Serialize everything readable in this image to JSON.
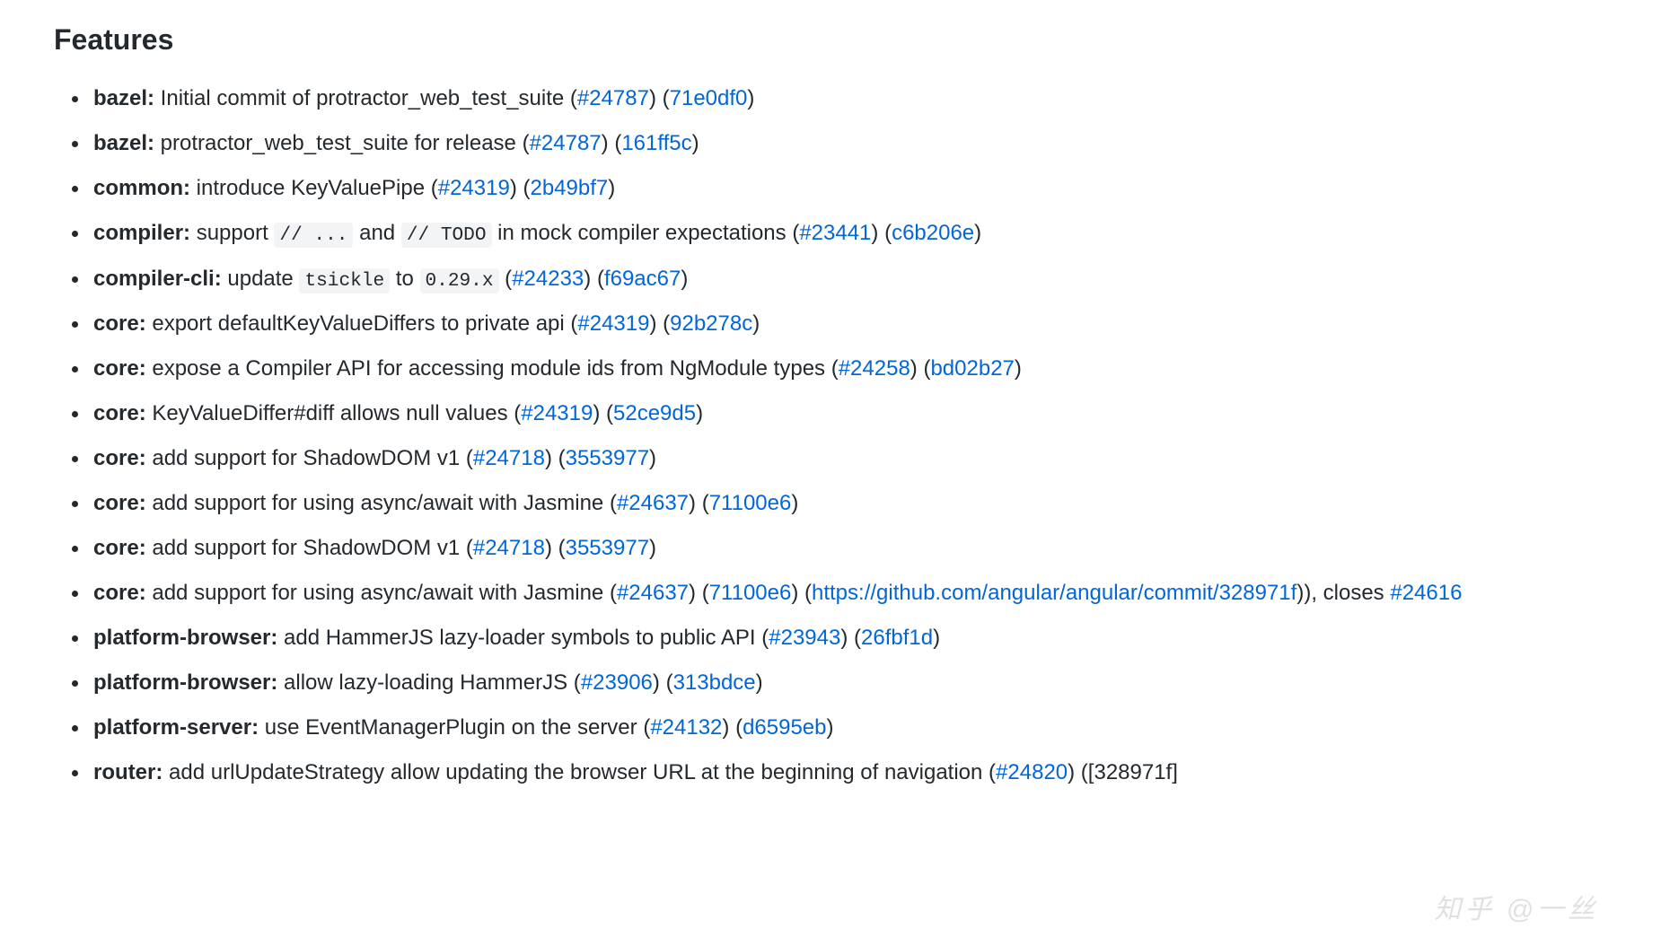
{
  "heading": "Features",
  "items": [
    {
      "mod": "bazel:",
      "parts": [
        {
          "t": "text",
          "v": " Initial commit of protractor_web_test_suite ("
        },
        {
          "t": "link",
          "v": "#24787"
        },
        {
          "t": "text",
          "v": ") ("
        },
        {
          "t": "link",
          "v": "71e0df0"
        },
        {
          "t": "text",
          "v": ")"
        }
      ]
    },
    {
      "mod": "bazel:",
      "parts": [
        {
          "t": "text",
          "v": " protractor_web_test_suite for release ("
        },
        {
          "t": "link",
          "v": "#24787"
        },
        {
          "t": "text",
          "v": ") ("
        },
        {
          "t": "link",
          "v": "161ff5c"
        },
        {
          "t": "text",
          "v": ")"
        }
      ]
    },
    {
      "mod": "common:",
      "parts": [
        {
          "t": "text",
          "v": " introduce KeyValuePipe ("
        },
        {
          "t": "link",
          "v": "#24319"
        },
        {
          "t": "text",
          "v": ") ("
        },
        {
          "t": "link",
          "v": "2b49bf7"
        },
        {
          "t": "text",
          "v": ")"
        }
      ]
    },
    {
      "mod": "compiler:",
      "parts": [
        {
          "t": "text",
          "v": " support "
        },
        {
          "t": "code",
          "v": "// ..."
        },
        {
          "t": "text",
          "v": " and "
        },
        {
          "t": "code",
          "v": "// TODO"
        },
        {
          "t": "text",
          "v": " in mock compiler expectations ("
        },
        {
          "t": "link",
          "v": "#23441"
        },
        {
          "t": "text",
          "v": ") ("
        },
        {
          "t": "link",
          "v": "c6b206e"
        },
        {
          "t": "text",
          "v": ")"
        }
      ]
    },
    {
      "mod": "compiler-cli:",
      "parts": [
        {
          "t": "text",
          "v": " update "
        },
        {
          "t": "code",
          "v": "tsickle"
        },
        {
          "t": "text",
          "v": " to "
        },
        {
          "t": "code",
          "v": "0.29.x"
        },
        {
          "t": "text",
          "v": " ("
        },
        {
          "t": "link",
          "v": "#24233"
        },
        {
          "t": "text",
          "v": ") ("
        },
        {
          "t": "link",
          "v": "f69ac67"
        },
        {
          "t": "text",
          "v": ")"
        }
      ]
    },
    {
      "mod": "core:",
      "parts": [
        {
          "t": "text",
          "v": " export defaultKeyValueDiffers to private api ("
        },
        {
          "t": "link",
          "v": "#24319"
        },
        {
          "t": "text",
          "v": ") ("
        },
        {
          "t": "link",
          "v": "92b278c"
        },
        {
          "t": "text",
          "v": ")"
        }
      ]
    },
    {
      "mod": "core:",
      "parts": [
        {
          "t": "text",
          "v": " expose a Compiler API for accessing module ids from NgModule types ("
        },
        {
          "t": "link",
          "v": "#24258"
        },
        {
          "t": "text",
          "v": ") ("
        },
        {
          "t": "link",
          "v": "bd02b27"
        },
        {
          "t": "text",
          "v": ")"
        }
      ]
    },
    {
      "mod": "core:",
      "parts": [
        {
          "t": "text",
          "v": " KeyValueDiffer#diff allows null values ("
        },
        {
          "t": "link",
          "v": "#24319"
        },
        {
          "t": "text",
          "v": ") ("
        },
        {
          "t": "link",
          "v": "52ce9d5"
        },
        {
          "t": "text",
          "v": ")"
        }
      ]
    },
    {
      "mod": "core:",
      "parts": [
        {
          "t": "text",
          "v": " add support for ShadowDOM v1 ("
        },
        {
          "t": "link",
          "v": "#24718"
        },
        {
          "t": "text",
          "v": ") ("
        },
        {
          "t": "link",
          "v": "3553977"
        },
        {
          "t": "text",
          "v": ")"
        }
      ]
    },
    {
      "mod": "core:",
      "parts": [
        {
          "t": "text",
          "v": " add support for using async/await with Jasmine ("
        },
        {
          "t": "link",
          "v": "#24637"
        },
        {
          "t": "text",
          "v": ") ("
        },
        {
          "t": "link",
          "v": "71100e6"
        },
        {
          "t": "text",
          "v": ")"
        }
      ]
    },
    {
      "mod": "core:",
      "parts": [
        {
          "t": "text",
          "v": " add support for ShadowDOM v1 ("
        },
        {
          "t": "link",
          "v": "#24718"
        },
        {
          "t": "text",
          "v": ") ("
        },
        {
          "t": "link",
          "v": "3553977"
        },
        {
          "t": "text",
          "v": ")"
        }
      ]
    },
    {
      "mod": "core:",
      "parts": [
        {
          "t": "text",
          "v": " add support for using async/await with Jasmine ("
        },
        {
          "t": "link",
          "v": "#24637"
        },
        {
          "t": "text",
          "v": ") ("
        },
        {
          "t": "link",
          "v": "71100e6"
        },
        {
          "t": "text",
          "v": ") ("
        },
        {
          "t": "link",
          "v": "https://github.com/angular/angular/commit/328971f"
        },
        {
          "t": "text",
          "v": ")), closes "
        },
        {
          "t": "link",
          "v": "#24616"
        }
      ]
    },
    {
      "mod": "platform-browser:",
      "parts": [
        {
          "t": "text",
          "v": " add HammerJS lazy-loader symbols to public API ("
        },
        {
          "t": "link",
          "v": "#23943"
        },
        {
          "t": "text",
          "v": ") ("
        },
        {
          "t": "link",
          "v": "26fbf1d"
        },
        {
          "t": "text",
          "v": ")"
        }
      ]
    },
    {
      "mod": "platform-browser:",
      "parts": [
        {
          "t": "text",
          "v": " allow lazy-loading HammerJS ("
        },
        {
          "t": "link",
          "v": "#23906"
        },
        {
          "t": "text",
          "v": ") ("
        },
        {
          "t": "link",
          "v": "313bdce"
        },
        {
          "t": "text",
          "v": ")"
        }
      ]
    },
    {
      "mod": "platform-server:",
      "parts": [
        {
          "t": "text",
          "v": " use EventManagerPlugin on the server ("
        },
        {
          "t": "link",
          "v": "#24132"
        },
        {
          "t": "text",
          "v": ") ("
        },
        {
          "t": "link",
          "v": "d6595eb"
        },
        {
          "t": "text",
          "v": ")"
        }
      ]
    },
    {
      "mod": "router:",
      "parts": [
        {
          "t": "text",
          "v": " add urlUpdateStrategy allow updating the browser URL at the beginning of navigation ("
        },
        {
          "t": "link",
          "v": "#24820"
        },
        {
          "t": "text",
          "v": ") (["
        },
        {
          "t": "text",
          "v": "328971f]"
        }
      ]
    }
  ],
  "watermark": "知乎 @一丝"
}
